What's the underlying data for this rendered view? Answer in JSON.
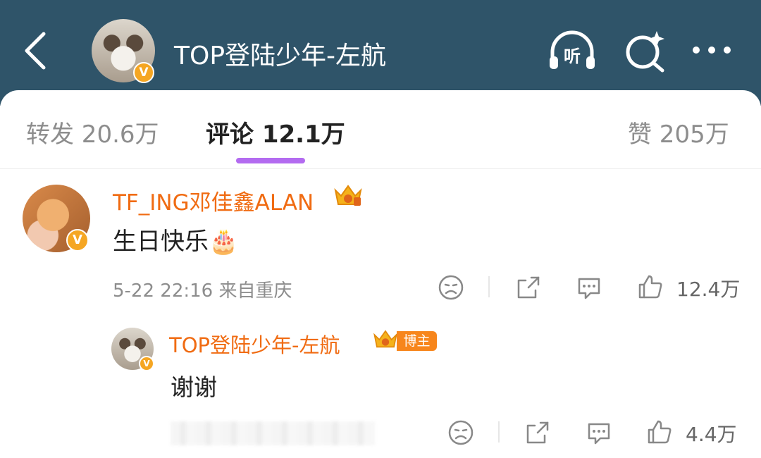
{
  "header": {
    "title": "TOP登陆少年-左航",
    "listen_label": "听",
    "icons": [
      "back-arrow-icon",
      "listen-headphones-icon",
      "search-sparkle-icon",
      "more-dots-icon"
    ],
    "colors": {
      "background": "#2f5469",
      "text": "#ffffff"
    }
  },
  "tabs": {
    "repost": "转发 20.6万",
    "comments": "评论 12.1万",
    "likes": "赞 205万",
    "active": "comments",
    "underline_color": "#b36bf0"
  },
  "comments": [
    {
      "username": "TF_ING邓佳鑫ALAN",
      "text": "生日快乐",
      "emoji": "🎂",
      "time": "5-22 22:16",
      "location": "来自重庆",
      "likes": "12.4万",
      "verified": true
    }
  ],
  "reply": {
    "username": "TOP登陆少年-左航",
    "tag": "博主",
    "text": "谢谢",
    "likes": "4.4万",
    "verified": true
  },
  "badge_letter": "V",
  "colors": {
    "username": "#f06b12",
    "meta": "#8d8d8d",
    "badge": "#f5a623"
  }
}
